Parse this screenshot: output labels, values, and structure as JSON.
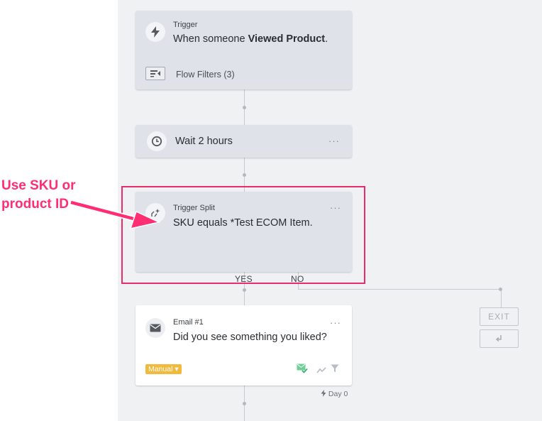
{
  "trigger": {
    "kicker": "Trigger",
    "text_prefix": "When someone ",
    "text_bold": "Viewed Product",
    "text_suffix": ".",
    "filters_label": "Flow Filters (3)"
  },
  "wait": {
    "label": "Wait 2 hours",
    "menu": "···"
  },
  "split": {
    "kicker": "Trigger Split",
    "text_bold": "SKU",
    "text_rest": " equals *Test ECOM Item.",
    "menu": "···",
    "yes_label": "YES",
    "no_label": "NO"
  },
  "annotation": {
    "line1": "Use SKU or",
    "line2": "product ID",
    "color": "#ff2d72"
  },
  "exit": {
    "exit_label": "EXIT"
  },
  "email": {
    "kicker": "Email #1",
    "subject": "Did you see something you liked?",
    "menu": "···",
    "status_badge": "Manual ▾",
    "badge_color": "#f2b93c"
  },
  "timing": {
    "day_label": "Day 0"
  }
}
